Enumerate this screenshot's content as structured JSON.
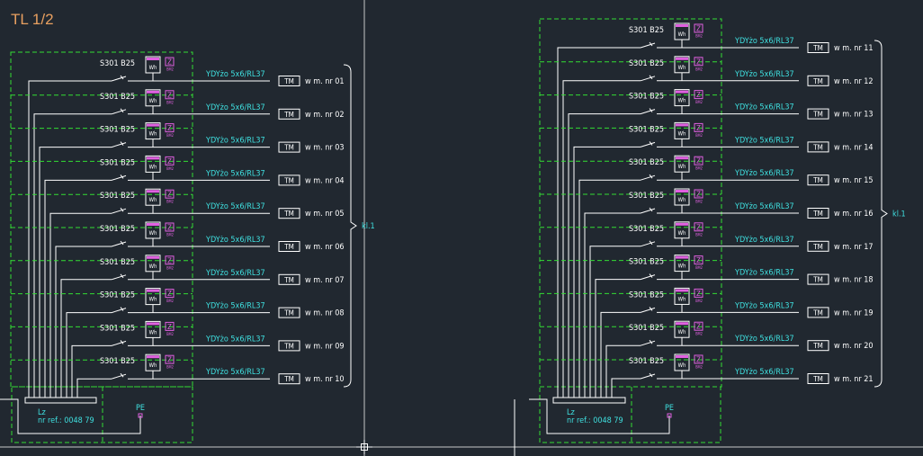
{
  "sheet_title": "TL 1/2",
  "colors": {
    "background": "#212830",
    "wire": "#ffffff",
    "enclosure": "#33dd33",
    "cyan_text": "#3fe0e0",
    "magenta": "#e060e0",
    "title": "#e8a060"
  },
  "panels": [
    {
      "id": "left",
      "bracket_label": "kl.1",
      "busbar_label": "Lz",
      "ref_label": "nr ref.: 0048 79",
      "pe_label": "PE",
      "circuits": [
        {
          "breaker": "S301 B25",
          "meter": "Wh",
          "z": "Z",
          "z_small": "BM2",
          "cable": "YDYżo 5x6/RL37",
          "tm": "TM",
          "dest": "w m. nr 01"
        },
        {
          "breaker": "S301 B25",
          "meter": "Wh",
          "z": "Z",
          "z_small": "BM2",
          "cable": "YDYżo 5x6/RL37",
          "tm": "TM",
          "dest": "w m. nr 02"
        },
        {
          "breaker": "S301 B25",
          "meter": "Wh",
          "z": "Z",
          "z_small": "BM2",
          "cable": "YDYżo 5x6/RL37",
          "tm": "TM",
          "dest": "w m. nr 03"
        },
        {
          "breaker": "S301 B25",
          "meter": "Wh",
          "z": "Z",
          "z_small": "BM2",
          "cable": "YDYżo 5x6/RL37",
          "tm": "TM",
          "dest": "w m. nr 04"
        },
        {
          "breaker": "S301 B25",
          "meter": "Wh",
          "z": "Z",
          "z_small": "BM2",
          "cable": "YDYżo 5x6/RL37",
          "tm": "TM",
          "dest": "w m. nr 05"
        },
        {
          "breaker": "S301 B25",
          "meter": "Wh",
          "z": "Z",
          "z_small": "BM2",
          "cable": "YDYżo 5x6/RL37",
          "tm": "TM",
          "dest": "w m. nr 06"
        },
        {
          "breaker": "S301 B25",
          "meter": "Wh",
          "z": "Z",
          "z_small": "BM2",
          "cable": "YDYżo 5x6/RL37",
          "tm": "TM",
          "dest": "w m. nr 07"
        },
        {
          "breaker": "S301 B25",
          "meter": "Wh",
          "z": "Z",
          "z_small": "BM2",
          "cable": "YDYżo 5x6/RL37",
          "tm": "TM",
          "dest": "w m. nr 08"
        },
        {
          "breaker": "S301 B25",
          "meter": "Wh",
          "z": "Z",
          "z_small": "BM2",
          "cable": "YDYżo 5x6/RL37",
          "tm": "TM",
          "dest": "w m. nr 09"
        },
        {
          "breaker": "S301 B25",
          "meter": "Wh",
          "z": "Z",
          "z_small": "BM2",
          "cable": "YDYżo 5x6/RL37",
          "tm": "TM",
          "dest": "w m. nr 10"
        }
      ]
    },
    {
      "id": "right",
      "bracket_label": "kl.1",
      "busbar_label": "Lz",
      "ref_label": "nr ref.: 0048 79",
      "pe_label": "PE",
      "circuits": [
        {
          "breaker": "S301 B25",
          "meter": "Wh",
          "z": "Z",
          "z_small": "BM2",
          "cable": "YDYżo 5x6/RL37",
          "tm": "TM",
          "dest": "w m. nr 11"
        },
        {
          "breaker": "S301 B25",
          "meter": "Wh",
          "z": "Z",
          "z_small": "BM2",
          "cable": "YDYżo 5x6/RL37",
          "tm": "TM",
          "dest": "w m. nr 12"
        },
        {
          "breaker": "S301 B25",
          "meter": "Wh",
          "z": "Z",
          "z_small": "BM2",
          "cable": "YDYżo 5x6/RL37",
          "tm": "TM",
          "dest": "w m. nr 13"
        },
        {
          "breaker": "S301 B25",
          "meter": "Wh",
          "z": "Z",
          "z_small": "BM2",
          "cable": "YDYżo 5x6/RL37",
          "tm": "TM",
          "dest": "w m. nr 14"
        },
        {
          "breaker": "S301 B25",
          "meter": "Wh",
          "z": "Z",
          "z_small": "BM2",
          "cable": "YDYżo 5x6/RL37",
          "tm": "TM",
          "dest": "w m. nr 15"
        },
        {
          "breaker": "S301 B25",
          "meter": "Wh",
          "z": "Z",
          "z_small": "BM2",
          "cable": "YDYżo 5x6/RL37",
          "tm": "TM",
          "dest": "w m. nr 16"
        },
        {
          "breaker": "S301 B25",
          "meter": "Wh",
          "z": "Z",
          "z_small": "BM2",
          "cable": "YDYżo 5x6/RL37",
          "tm": "TM",
          "dest": "w m. nr 17"
        },
        {
          "breaker": "S301 B25",
          "meter": "Wh",
          "z": "Z",
          "z_small": "BM2",
          "cable": "YDYżo 5x6/RL37",
          "tm": "TM",
          "dest": "w m. nr 18"
        },
        {
          "breaker": "S301 B25",
          "meter": "Wh",
          "z": "Z",
          "z_small": "BM2",
          "cable": "YDYżo 5x6/RL37",
          "tm": "TM",
          "dest": "w m. nr 19"
        },
        {
          "breaker": "S301 B25",
          "meter": "Wh",
          "z": "Z",
          "z_small": "BM2",
          "cable": "YDYżo 5x6/RL37",
          "tm": "TM",
          "dest": "w m. nr 20"
        },
        {
          "breaker": "S301 B25",
          "meter": "Wh",
          "z": "Z",
          "z_small": "BM2",
          "cable": "YDYżo 5x6/RL37",
          "tm": "TM",
          "dest": "w m. nr 21"
        }
      ]
    }
  ]
}
